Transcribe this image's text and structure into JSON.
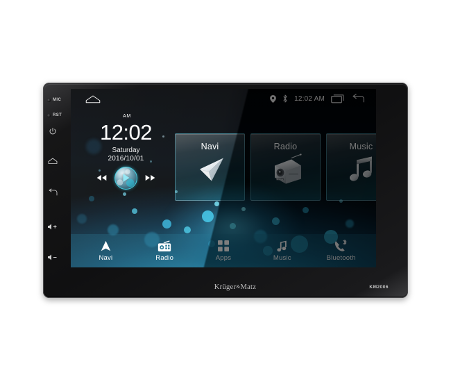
{
  "device": {
    "brand": "Krüger",
    "brand_amp": "&",
    "brand_suffix": "Matz",
    "model": "KM2006",
    "side_buttons": [
      {
        "name": "mic",
        "label": "MIC",
        "type": "led"
      },
      {
        "name": "reset",
        "label": "RST",
        "type": "led"
      },
      {
        "name": "power",
        "label": "",
        "type": "icon"
      },
      {
        "name": "home",
        "label": "",
        "type": "icon"
      },
      {
        "name": "back",
        "label": "",
        "type": "icon"
      },
      {
        "name": "volume-up",
        "label": "",
        "type": "icon"
      },
      {
        "name": "volume-down",
        "label": "",
        "type": "icon"
      }
    ]
  },
  "status_bar": {
    "home_icon": "home-pentagon-icon",
    "location_icon": "location-pin-icon",
    "bluetooth_icon": "bluetooth-icon",
    "clock": "12:02 AM",
    "recents_icon": "recent-apps-icon",
    "back_icon": "back-arrow-icon"
  },
  "clock_widget": {
    "ampm": "AM",
    "time": "12:02",
    "day": "Saturday",
    "date": "2016/10/01",
    "prev_icon": "previous-track-icon",
    "play_icon": "play-icon",
    "next_icon": "next-track-icon"
  },
  "cards": [
    {
      "label": "Navi",
      "icon": "navigation-arrow-icon"
    },
    {
      "label": "Radio",
      "icon": "radio-receiver-icon"
    },
    {
      "label": "Music",
      "icon": "music-note-icon"
    }
  ],
  "dock": [
    {
      "label": "Navi",
      "icon": "navigation-arrow-icon"
    },
    {
      "label": "Radio",
      "icon": "radio-icon"
    },
    {
      "label": "Apps",
      "icon": "apps-grid-icon"
    },
    {
      "label": "Music",
      "icon": "music-note-icon"
    },
    {
      "label": "Bluetooth",
      "icon": "bluetooth-phone-icon"
    }
  ],
  "colors": {
    "accent_cyan": "#2fb4d8",
    "bokeh_light": "#3fc9e8",
    "screen_bg": "#05080c",
    "chassis": "#16161a",
    "text_white": "#ffffff"
  }
}
